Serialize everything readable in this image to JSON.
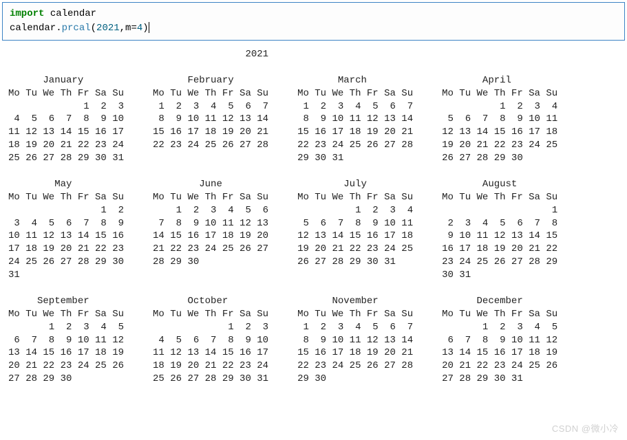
{
  "code": {
    "line1_kw": "import",
    "line1_rest": " calendar",
    "line2_obj": "calendar.",
    "line2_fn": "prcal",
    "line2_paren_open": "(",
    "line2_arg1": "2021",
    "line2_comma": ",m=",
    "line2_arg2": "4",
    "line2_paren_close": ")"
  },
  "calendar_output": "                                         2021\n\n      January                  February                  March                    April\nMo Tu We Th Fr Sa Su     Mo Tu We Th Fr Sa Su     Mo Tu We Th Fr Sa Su     Mo Tu We Th Fr Sa Su\n             1  2  3      1  2  3  4  5  6  7      1  2  3  4  5  6  7               1  2  3  4\n 4  5  6  7  8  9 10      8  9 10 11 12 13 14      8  9 10 11 12 13 14      5  6  7  8  9 10 11\n11 12 13 14 15 16 17     15 16 17 18 19 20 21     15 16 17 18 19 20 21     12 13 14 15 16 17 18\n18 19 20 21 22 23 24     22 23 24 25 26 27 28     22 23 24 25 26 27 28     19 20 21 22 23 24 25\n25 26 27 28 29 30 31                              29 30 31                 26 27 28 29 30\n\n        May                      June                     July                    August\nMo Tu We Th Fr Sa Su     Mo Tu We Th Fr Sa Su     Mo Tu We Th Fr Sa Su     Mo Tu We Th Fr Sa Su\n                1  2         1  2  3  4  5  6               1  2  3  4                        1\n 3  4  5  6  7  8  9      7  8  9 10 11 12 13      5  6  7  8  9 10 11      2  3  4  5  6  7  8\n10 11 12 13 14 15 16     14 15 16 17 18 19 20     12 13 14 15 16 17 18      9 10 11 12 13 14 15\n17 18 19 20 21 22 23     21 22 23 24 25 26 27     19 20 21 22 23 24 25     16 17 18 19 20 21 22\n24 25 26 27 28 29 30     28 29 30                 26 27 28 29 30 31        23 24 25 26 27 28 29\n31                                                                         30 31\n\n     September                 October                  November                 December\nMo Tu We Th Fr Sa Su     Mo Tu We Th Fr Sa Su     Mo Tu We Th Fr Sa Su     Mo Tu We Th Fr Sa Su\n       1  2  3  4  5                  1  2  3      1  2  3  4  5  6  7            1  2  3  4  5\n 6  7  8  9 10 11 12      4  5  6  7  8  9 10      8  9 10 11 12 13 14      6  7  8  9 10 11 12\n13 14 15 16 17 18 19     11 12 13 14 15 16 17     15 16 17 18 19 20 21     13 14 15 16 17 18 19\n20 21 22 23 24 25 26     18 19 20 21 22 23 24     22 23 24 25 26 27 28     20 21 22 23 24 25 26\n27 28 29 30              25 26 27 28 29 30 31     29 30                    27 28 29 30 31",
  "watermark": "CSDN @微小冷"
}
